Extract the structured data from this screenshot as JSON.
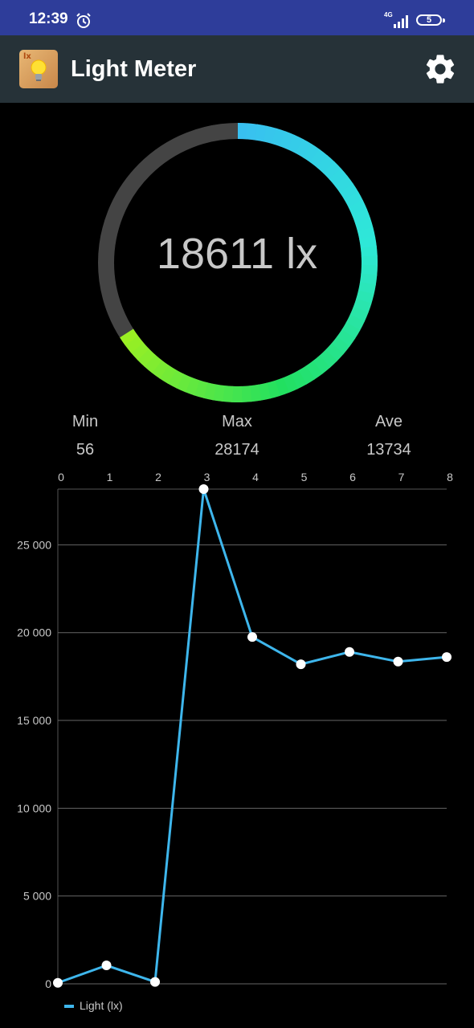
{
  "status_bar": {
    "time": "12:39",
    "network": "4G",
    "battery": "5"
  },
  "app_bar": {
    "logo_text": "lx",
    "title": "Light Meter",
    "settings_icon": "gear-icon"
  },
  "gauge": {
    "value_text": "18611 lx",
    "level": 0.66,
    "colors": [
      "#38c0f0",
      "#2ee8d8",
      "#22e060",
      "#a0f020"
    ],
    "track_color": "#444444"
  },
  "stats": {
    "min_label": "Min",
    "min_value": "56",
    "max_label": "Max",
    "max_value": "28174",
    "ave_label": "Ave",
    "ave_value": "13734"
  },
  "chart_data": {
    "type": "line",
    "x": [
      0,
      1,
      2,
      3,
      4,
      5,
      6,
      7,
      8
    ],
    "series": [
      {
        "name": "Light  (lx)",
        "color": "#3eb6ec",
        "values": [
          56,
          1050,
          110,
          28174,
          19750,
          18200,
          18900,
          18350,
          18611
        ]
      }
    ],
    "x_ticks": [
      "0",
      "1",
      "2",
      "3",
      "4",
      "5",
      "6",
      "7",
      "8"
    ],
    "y_ticks": [
      0,
      5000,
      10000,
      15000,
      20000,
      25000
    ],
    "y_tick_labels": [
      "0",
      "5 000",
      "10 000",
      "15 000",
      "20 000",
      "25 000"
    ],
    "ylim": [
      0,
      28174
    ],
    "xlim": [
      0,
      8
    ],
    "x_axis_position": "top",
    "grid": true,
    "legend": "bottom-left"
  },
  "legend": {
    "label": "Light  (lx)"
  }
}
